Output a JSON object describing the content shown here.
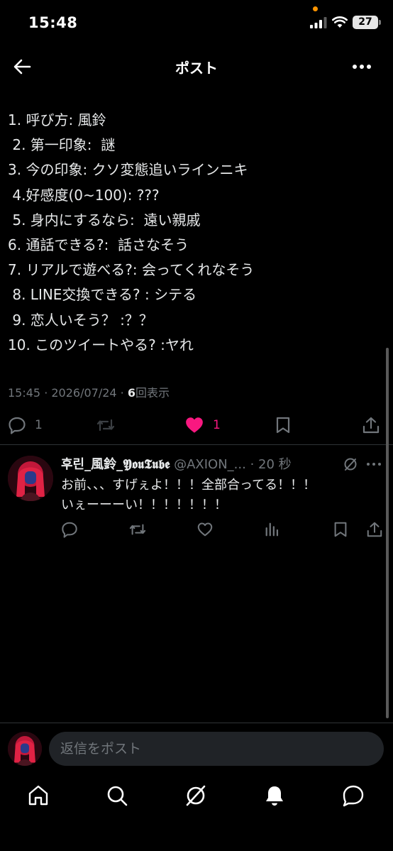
{
  "status_bar": {
    "time": "15:48",
    "battery": "27"
  },
  "header": {
    "title": "ポスト"
  },
  "post": {
    "lines": [
      "1. 呼び方: 風鈴",
      " 2. 第一印象:  謎",
      "3. 今の印象: クソ変態追いラインニキ",
      " 4.好感度(0~100): ???",
      " 5. 身内にするなら:  遠い親戚",
      "6. 通話できる?:  話さなそう",
      "7. リアルで遊べる?: 会ってくれなそう",
      " 8. LINE交換できる? : シテる",
      " 9. 恋人いそう？ :？？",
      "10. このツイートやる? :ヤれ"
    ],
    "meta_time": "15:45 · 2026/07/24 · ",
    "meta_views_count": "6",
    "meta_views_label": "回表示",
    "actions": {
      "reply_count": "1",
      "repost_count": "",
      "like_count": "1"
    }
  },
  "reply": {
    "name": "후린_風鈴_𝖄𝖔𝖚𝕿𝖚𝖇𝖊",
    "handle": "@AXION_...",
    "time": "· 20 秒",
    "text_line1": "お前、、、すげぇよ！！！全部合ってる！！！",
    "text_line2": "いぇーーーい！！！！！！！"
  },
  "composer": {
    "placeholder": "返信をポスト"
  },
  "colors": {
    "background": "#000000",
    "text": "#e7e9ea",
    "secondary": "#71767b",
    "like_pink": "#f91880",
    "divider": "#2f3336",
    "input_bg": "#202327"
  },
  "icons": {
    "header": [
      "back-arrow-icon",
      "more-icon"
    ],
    "post_actions": [
      "reply-icon",
      "repost-icon",
      "heart-filled-icon",
      "bookmark-icon",
      "share-icon"
    ],
    "reply_actions": [
      "reply-icon",
      "repost-icon",
      "heart-icon",
      "views-icon",
      "bookmark-icon",
      "share-icon"
    ],
    "bottom_nav": [
      "home-icon",
      "search-icon",
      "grok-icon",
      "notifications-icon",
      "messages-icon"
    ]
  }
}
